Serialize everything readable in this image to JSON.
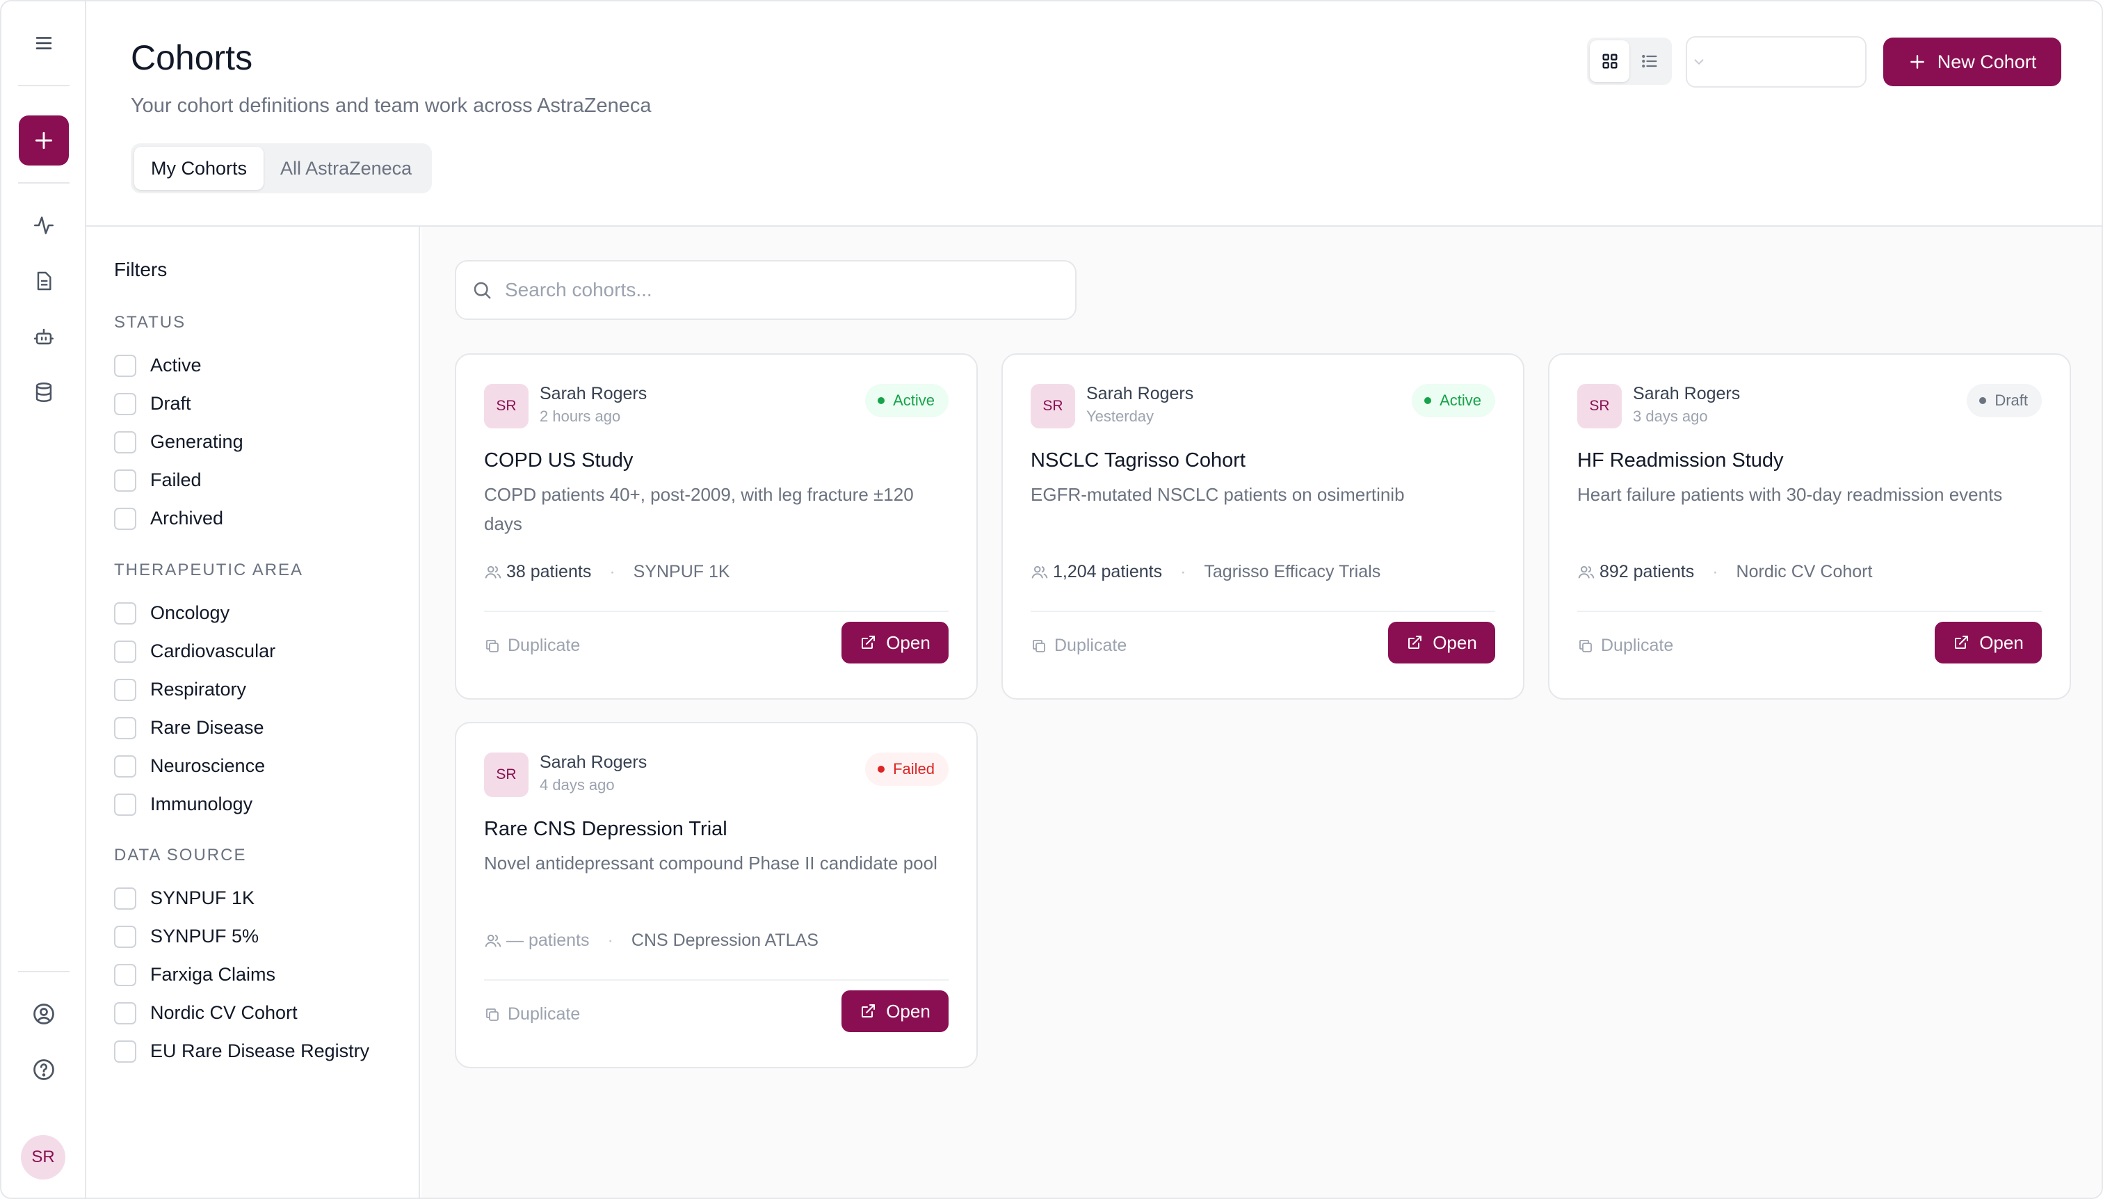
{
  "header": {
    "title": "Cohorts",
    "subtitle": "Your cohort definitions and team work across AstraZeneca",
    "tabs": [
      {
        "label": "My Cohorts",
        "active": true
      },
      {
        "label": "All AstraZeneca",
        "active": false
      }
    ],
    "view_mode": "grid",
    "select_value": "",
    "new_button_label": "New Cohort"
  },
  "sidebar": {
    "avatar_initials": "SR",
    "icons": [
      "menu-icon",
      "plus-icon",
      "activity-icon",
      "document-icon",
      "robot-icon",
      "database-icon",
      "user-circle-icon",
      "help-icon"
    ]
  },
  "filters": {
    "title": "Filters",
    "groups": [
      {
        "title": "STATUS",
        "items": [
          "Active",
          "Draft",
          "Generating",
          "Failed",
          "Archived"
        ]
      },
      {
        "title": "THERAPEUTIC AREA",
        "items": [
          "Oncology",
          "Cardiovascular",
          "Respiratory",
          "Rare Disease",
          "Neuroscience",
          "Immunology"
        ]
      },
      {
        "title": "DATA SOURCE",
        "items": [
          "SYNPUF 1K",
          "SYNPUF 5%",
          "Farxiga Claims",
          "Nordic CV Cohort",
          "EU Rare Disease Registry"
        ]
      }
    ]
  },
  "search": {
    "placeholder": "Search cohorts..."
  },
  "cards": [
    {
      "initials": "SR",
      "owner": "Sarah Rogers",
      "time": "2 hours ago",
      "status": "Active",
      "title": "COPD US Study",
      "description": "COPD patients 40+, post-2009, with leg fracture ±120 days",
      "patients": "38 patients",
      "source": "SYNPUF 1K",
      "duplicate_label": "Duplicate",
      "open_label": "Open"
    },
    {
      "initials": "SR",
      "owner": "Sarah Rogers",
      "time": "Yesterday",
      "status": "Active",
      "title": "NSCLC Tagrisso Cohort",
      "description": "EGFR-mutated NSCLC patients on osimertinib",
      "patients": "1,204 patients",
      "source": "Tagrisso Efficacy Trials",
      "duplicate_label": "Duplicate",
      "open_label": "Open"
    },
    {
      "initials": "SR",
      "owner": "Sarah Rogers",
      "time": "3 days ago",
      "status": "Draft",
      "title": "HF Readmission Study",
      "description": "Heart failure patients with 30-day readmission events",
      "patients": "892 patients",
      "source": "Nordic CV Cohort",
      "duplicate_label": "Duplicate",
      "open_label": "Open"
    },
    {
      "initials": "SR",
      "owner": "Sarah Rogers",
      "time": "4 days ago",
      "status": "Failed",
      "title": "Rare CNS Depression Trial",
      "description": "Novel antidepressant compound Phase II candidate pool",
      "patients": "— patients",
      "source": "CNS Depression ATLAS",
      "duplicate_label": "Duplicate",
      "open_label": "Open"
    }
  ],
  "colors": {
    "brand": "#8a0f52",
    "active_bg": "#ecfdf3",
    "active_fg": "#16a34a",
    "draft_bg": "#f3f4f6",
    "draft_fg": "#6b7280",
    "failed_bg": "#fef2f2",
    "failed_fg": "#dc2626"
  }
}
